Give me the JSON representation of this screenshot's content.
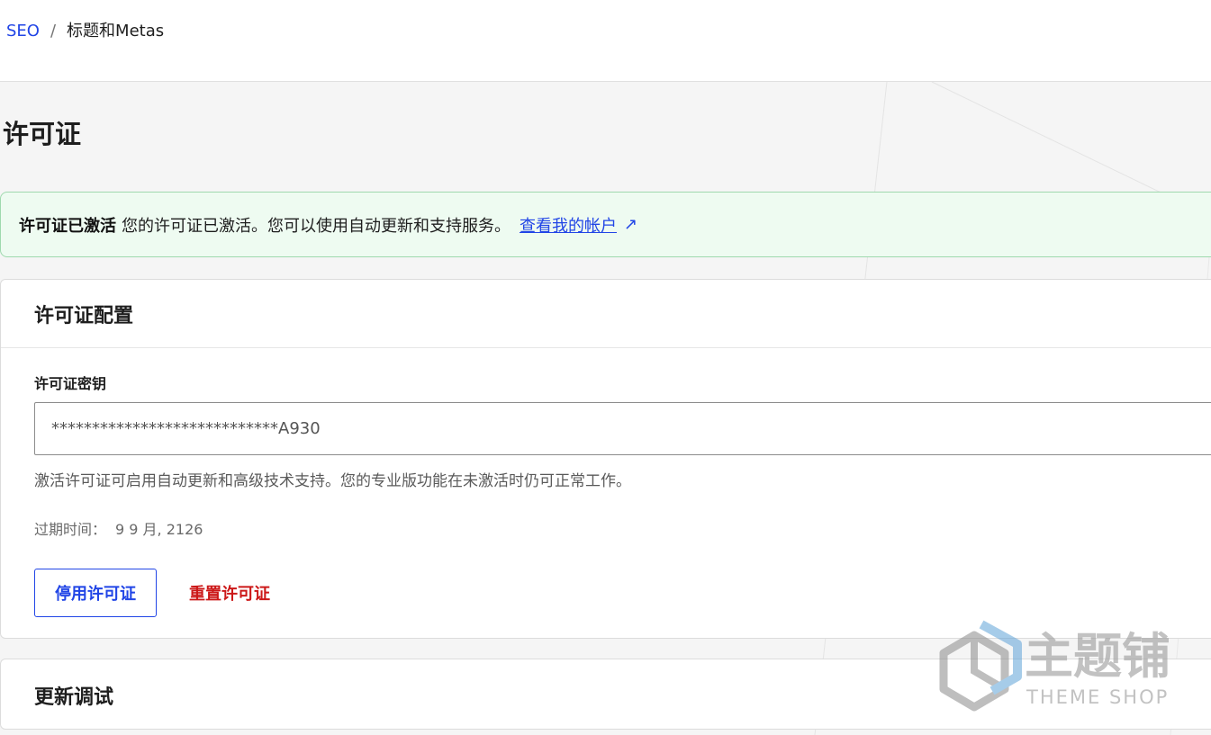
{
  "breadcrumb": {
    "root": "SEO",
    "separator": "/",
    "current": "标题和Metas"
  },
  "page": {
    "title": "许可证"
  },
  "notice": {
    "strong": "许可证已激活",
    "message": "您的许可证已激活。您可以使用自动更新和支持服务。",
    "link_label": "查看我的帐户",
    "link_icon": "external-link-icon",
    "link_icon_glyph": "↗"
  },
  "license_card": {
    "title": "许可证配置",
    "key_label": "许可证密钥",
    "key_value": "****************************A930",
    "help_text": "激活许可证可启用自动更新和高级技术支持。您的专业版功能在未激活时仍可正常工作。",
    "expiry_label": "过期时间：",
    "expiry_value": "9 9 月, 2126",
    "deactivate_label": "停用许可证",
    "reset_label": "重置许可证"
  },
  "update_card": {
    "title": "更新调试"
  },
  "watermark": {
    "brand": "主题铺",
    "sub": "THEME SHOP"
  },
  "colors": {
    "accent": "#2145e6",
    "danger": "#cc1818",
    "success_bg": "#eefbf1",
    "success_border": "#9fd9ae"
  }
}
